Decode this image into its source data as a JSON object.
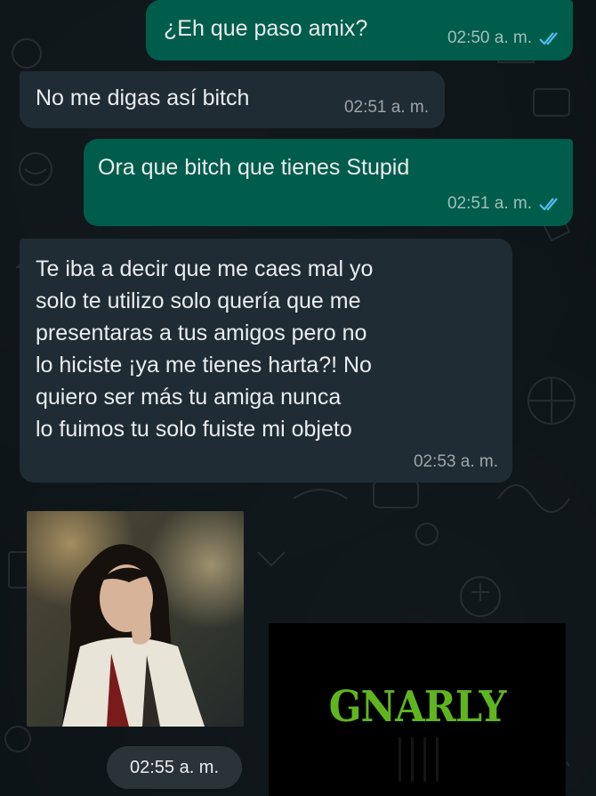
{
  "messages": [
    {
      "id": "m1",
      "direction": "out",
      "text": "¿Eh que paso amix?",
      "time": "02:50 a. m.",
      "status": "read"
    },
    {
      "id": "m2",
      "direction": "in",
      "text": "No me digas así bitch",
      "time": "02:51 a. m."
    },
    {
      "id": "m3",
      "direction": "out",
      "text": "Ora que bitch que tienes Stupid",
      "time": "02:51 a. m.",
      "status": "read"
    },
    {
      "id": "m4",
      "direction": "in",
      "text": "Te iba a decir que me caes mal yo\nsolo te utilizo solo quería que me\npresentaras a tus amigos pero no\nlo hiciste ¡ya me tienes harta?! No\nquiero ser más tu amiga nunca\nlo fuimos tu solo fuiste mi objeto",
      "time": "02:53 a. m."
    }
  ],
  "media": {
    "photo_icon": "photo-thumbnail",
    "sticker_text": "GNARLY",
    "time": "02:55 a. m."
  },
  "colors": {
    "background": "#0d1418",
    "outgoing_bubble": "#005c4b",
    "incoming_bubble": "#202c33",
    "read_ticks": "#53bdeb",
    "sticker_green": "#5fb51f"
  }
}
